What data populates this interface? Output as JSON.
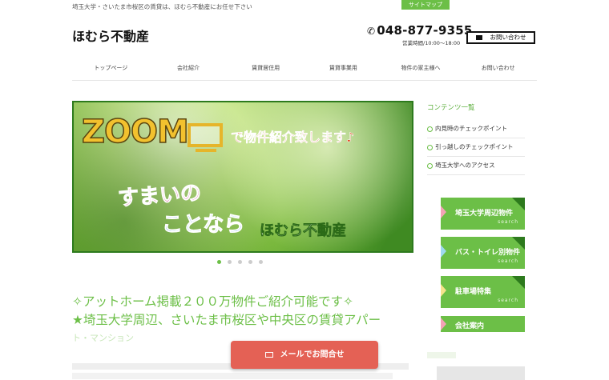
{
  "header": {
    "tagline": "埼玉大学・さいたま市桜区の賃貸は、ほむら不動産にお任せ下さい",
    "sitemap": "サイトマップ",
    "logo": "ほむら不動産",
    "phone": "048-877-9355",
    "hours": "営業時間/10:00～18:00",
    "contact": "お問い合わせ"
  },
  "nav": {
    "items": [
      "トップページ",
      "会社紹介",
      "賃貸居住用",
      "賃貸事業用",
      "物件の家主様へ",
      "お問い合わせ"
    ]
  },
  "slider": {
    "zoom": "ZOOM",
    "zoom_suffix": "で物件紹介致します♪",
    "sumai": "すまいの",
    "kotonara": "ことなら",
    "company": "ほむら不動産",
    "dots": 5,
    "active_dot": 0
  },
  "sidebar": {
    "title": "コンテンツ一覧",
    "links": [
      "内見時のチェックポイント",
      "引っ越しのチェックポイント",
      "埼玉大学へのアクセス"
    ],
    "banners": [
      {
        "label": "埼玉大学周辺物件",
        "sub": "search"
      },
      {
        "label": "バス・トイレ別物件",
        "sub": "search"
      },
      {
        "label": "駐車場特集",
        "sub": "search"
      },
      {
        "label": "会社案内",
        "sub": ""
      }
    ]
  },
  "main": {
    "heading1": "✧アットホーム掲載２００万物件ご紹介可能です✧",
    "heading2": "★埼玉大学周辺、さいたま市桜区や中央区の賃貸アパー",
    "heading3": "ト・マンション"
  },
  "mail_button": "メールでお問合せ",
  "colors": {
    "accent": "#6cbf47",
    "mail_button": "#e46155",
    "dark_green": "#2d7a1d"
  }
}
